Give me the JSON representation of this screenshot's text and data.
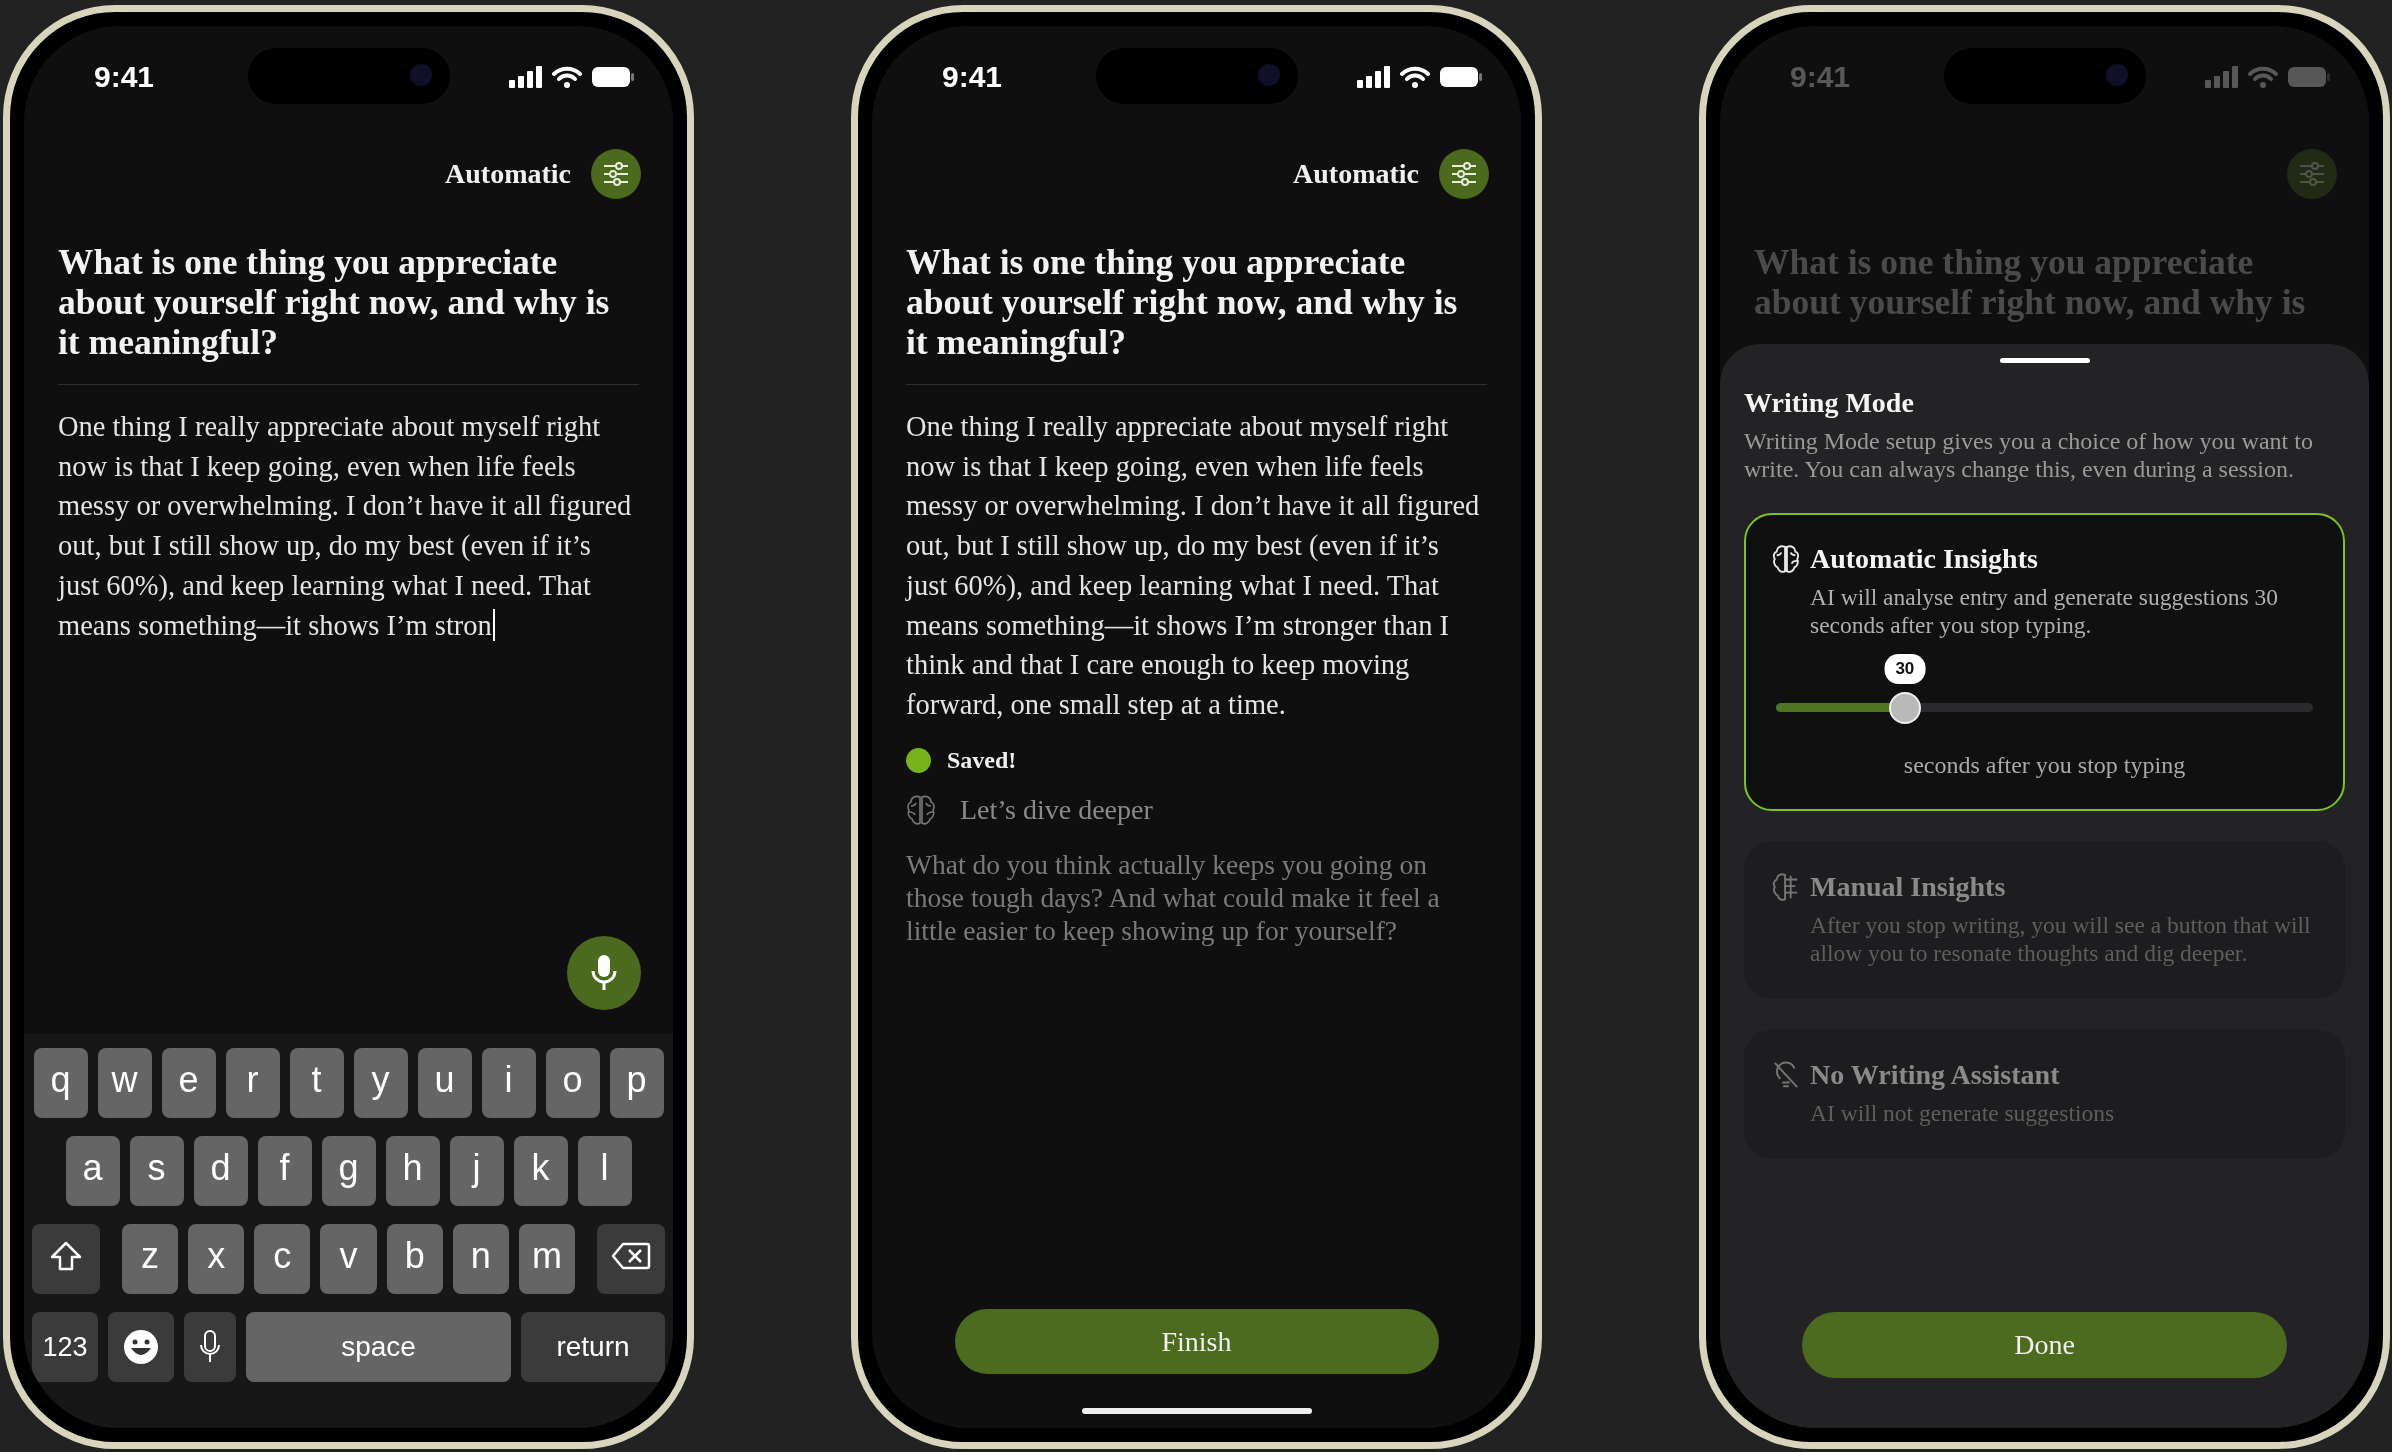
{
  "typing_screen": {
    "time": "9:41",
    "mode_label": "Automatic",
    "question": "What is one thing you appreciate about yourself right now, and why is it meaningful?",
    "entry": "One thing I really appreciate about myself right now is that I keep going, even when life feels messy or overwhelming. I don’t have it all figured out, but I still show up, do my best (even if it’s just 60%), and keep learning what I need. That means something—it shows I’m stron",
    "keyboard": [
      [
        {
          "kind": "letter",
          "label": "q"
        },
        {
          "kind": "letter",
          "label": "w"
        },
        {
          "kind": "letter",
          "label": "e"
        },
        {
          "kind": "letter",
          "label": "r"
        },
        {
          "kind": "letter",
          "label": "t"
        },
        {
          "kind": "letter",
          "label": "y"
        },
        {
          "kind": "letter",
          "label": "u"
        },
        {
          "kind": "letter",
          "label": "i"
        },
        {
          "kind": "letter",
          "label": "o"
        },
        {
          "kind": "letter",
          "label": "p"
        }
      ],
      [
        {
          "kind": "letter",
          "label": "a"
        },
        {
          "kind": "letter",
          "label": "s"
        },
        {
          "kind": "letter",
          "label": "d"
        },
        {
          "kind": "letter",
          "label": "f"
        },
        {
          "kind": "letter",
          "label": "g"
        },
        {
          "kind": "letter",
          "label": "h"
        },
        {
          "kind": "letter",
          "label": "j"
        },
        {
          "kind": "letter",
          "label": "k"
        },
        {
          "kind": "letter",
          "label": "l"
        }
      ],
      [
        {
          "kind": "shift"
        },
        {
          "kind": "letter",
          "label": "z"
        },
        {
          "kind": "letter",
          "label": "x"
        },
        {
          "kind": "letter",
          "label": "c"
        },
        {
          "kind": "letter",
          "label": "v"
        },
        {
          "kind": "letter",
          "label": "b"
        },
        {
          "kind": "letter",
          "label": "n"
        },
        {
          "kind": "letter",
          "label": "m"
        },
        {
          "kind": "delete"
        }
      ],
      [
        {
          "kind": "numbers",
          "label": "123"
        },
        {
          "kind": "emoji"
        },
        {
          "kind": "mic"
        },
        {
          "kind": "space",
          "label": "space"
        },
        {
          "kind": "return",
          "label": "return"
        }
      ]
    ]
  },
  "saved_screen": {
    "time": "9:41",
    "mode_label": "Automatic",
    "question": "What is one thing you appreciate about yourself right now, and why is it meaningful?",
    "entry": "One thing I really appreciate about myself right now is that I keep going, even when life feels messy or overwhelming. I don’t have it all figured out, but I still show up, do my best (even if it’s just 60%), and keep learning what I need. That means something—it shows I’m stronger than I think and that I care enough to keep moving forward, one small step at a time.",
    "saved_label": "Saved!",
    "prompt_label": "Let’s dive deeper",
    "follow_up": "What do you think actually keeps you going on those tough days? And what could make it feel a little easier to keep showing up for yourself?",
    "finish_button": "Finish"
  },
  "settings_screen": {
    "time": "9:41",
    "question": "What is one thing you appreciate about yourself right now, and why is",
    "sheet": {
      "title": "Writing Mode",
      "description": "Writing Mode setup gives you a choice of how you want to write. You can always change this, even during a session.",
      "options": [
        {
          "kind": "slider",
          "title": "Automatic Insights",
          "description": "AI will analyse entry and generate suggestions 30 seconds after you stop typing.",
          "selected": true,
          "slider": {
            "value": "30",
            "level": 0.24,
            "caption": "seconds after you stop typing"
          }
        },
        {
          "kind": "plain",
          "title": "Manual Insights",
          "description": "After you stop writing, you will see a button that will allow you to resonate thoughts and dig deeper.",
          "selected": false
        },
        {
          "kind": "plain",
          "title": "No Writing Assistant",
          "description": "AI will not generate suggestions",
          "selected": false
        }
      ],
      "done_button": "Done"
    }
  }
}
